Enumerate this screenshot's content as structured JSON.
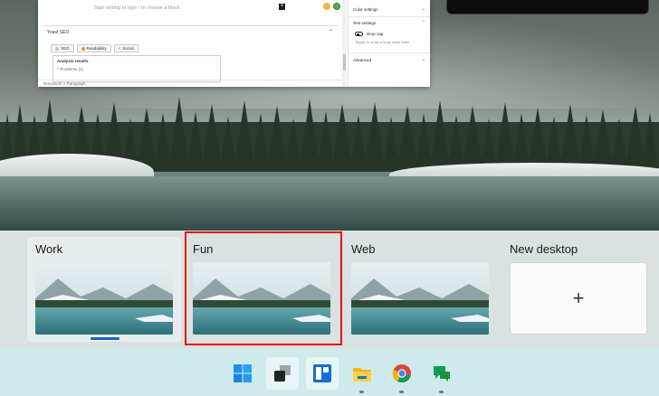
{
  "editor": {
    "placeholder": "Start writing or type / to choose a block",
    "add_block": "+",
    "yoast_title": "Yoast SEO",
    "tabs": [
      "SEO",
      "Readability",
      "Social"
    ],
    "analysis_title": "Analysis results",
    "analysis_item": "^ Problems (1)",
    "status": "Document  >  Paragraph"
  },
  "settings": {
    "color_settings": "Color settings",
    "text_settings": "Text settings",
    "drop_cap": "Drop cap",
    "hint": "Toggle to show a large initial letter.",
    "advanced": "Advanced"
  },
  "desktops": [
    {
      "label": "Work",
      "active": true
    },
    {
      "label": "Fun",
      "selected": true
    },
    {
      "label": "Web"
    }
  ],
  "new_desktop": {
    "label": "New desktop",
    "plus": "+"
  },
  "taskbar": {
    "icons": [
      "windows-start-icon",
      "task-view-icon",
      "widgets-icon",
      "file-explorer-icon",
      "chrome-icon",
      "google-chat-icon"
    ]
  },
  "colors": {
    "selection": "#e81010",
    "active_indicator": "#1565c0",
    "taskbar": "#cfeaea"
  }
}
